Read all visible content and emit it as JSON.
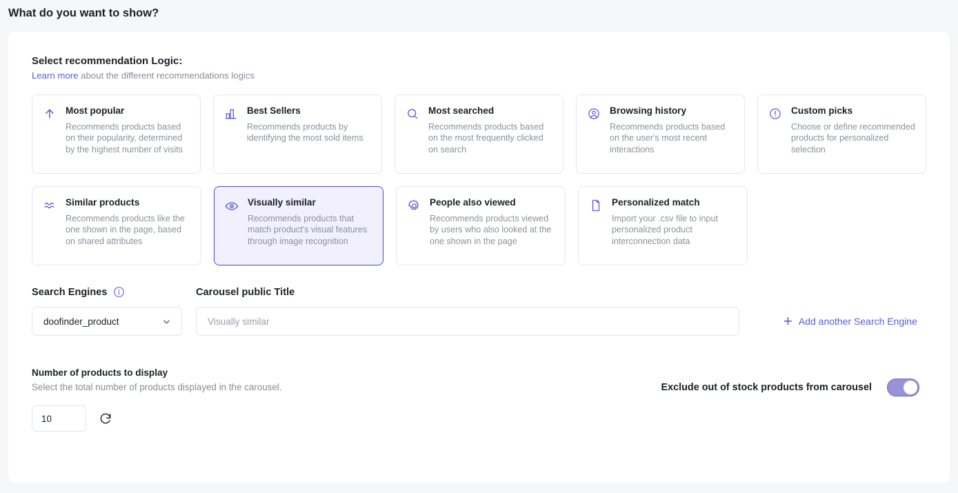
{
  "header": {
    "title": "What do you want to show?"
  },
  "logic_section": {
    "title": "Select recommendation Logic:",
    "sub_link": "Learn more",
    "sub_rest": " about the different recommendations logics",
    "accent_color": "#5b5bd6",
    "selected_border_color": "#4f46c9",
    "selected_bg_color": "#f1f0fc",
    "cards": [
      {
        "icon": "arrow-up-icon",
        "title": "Most popular",
        "desc": "Recommends products based on their popularity, determined by the highest number of visits",
        "selected": false
      },
      {
        "icon": "bar-chart-icon",
        "title": "Best Sellers",
        "desc": "Recommends products by identifying the most sold items",
        "selected": false
      },
      {
        "icon": "search-icon",
        "title": "Most searched",
        "desc": "Recommends products based on the most frequently clicked on search",
        "selected": false
      },
      {
        "icon": "user-circle-icon",
        "title": "Browsing history",
        "desc": "Recommends products based on the user's most recent interactions",
        "selected": false
      },
      {
        "icon": "alert-circle-icon",
        "title": "Custom picks",
        "desc": "Choose or define recommended products for personalized selection",
        "selected": false
      },
      {
        "icon": "approx-equal-icon",
        "title": "Similar products",
        "desc": "Recommends products like the one shown in the page, based on shared attributes",
        "selected": false
      },
      {
        "icon": "eye-icon",
        "title": "Visually similar",
        "desc": "Recommends products that match product's visual features through image recognition",
        "selected": true
      },
      {
        "icon": "gear-icon",
        "title": "People also viewed",
        "desc": "Recommends products viewed by users who also looked at the one shown in the page",
        "selected": false
      },
      {
        "icon": "document-icon",
        "title": "Personalized match",
        "desc": "Import your .csv file to input personalized product interconnection data",
        "selected": false
      }
    ]
  },
  "search_engines": {
    "label": "Search Engines",
    "carousel_title_label": "Carousel public Title",
    "selected_engine": "doofinder_product",
    "carousel_title_value": "",
    "carousel_title_placeholder": "Visually similar",
    "add_link": "Add another Search Engine"
  },
  "products": {
    "title": "Number of products to display",
    "sub": "Select the total number of products displayed in the carousel.",
    "count_value": "10",
    "exclude_label": "Exclude out of stock products from carousel",
    "exclude_enabled": true
  }
}
